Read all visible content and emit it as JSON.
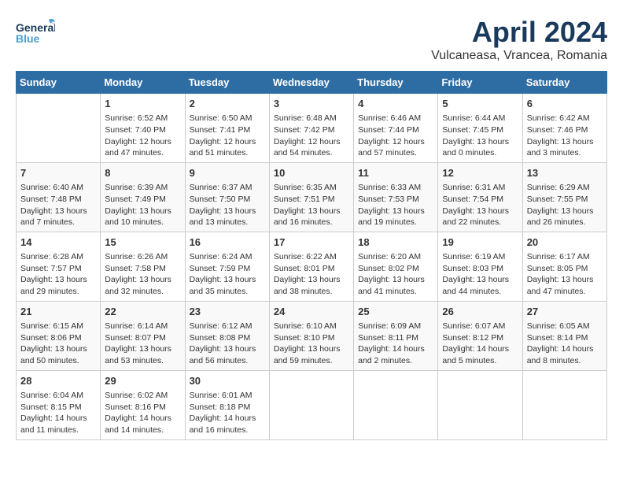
{
  "header": {
    "logo_general": "General",
    "logo_blue": "Blue",
    "month_title": "April 2024",
    "location": "Vulcaneasa, Vrancea, Romania"
  },
  "days_of_week": [
    "Sunday",
    "Monday",
    "Tuesday",
    "Wednesday",
    "Thursday",
    "Friday",
    "Saturday"
  ],
  "weeks": [
    [
      {
        "day": "",
        "info": ""
      },
      {
        "day": "1",
        "info": "Sunrise: 6:52 AM\nSunset: 7:40 PM\nDaylight: 12 hours\nand 47 minutes."
      },
      {
        "day": "2",
        "info": "Sunrise: 6:50 AM\nSunset: 7:41 PM\nDaylight: 12 hours\nand 51 minutes."
      },
      {
        "day": "3",
        "info": "Sunrise: 6:48 AM\nSunset: 7:42 PM\nDaylight: 12 hours\nand 54 minutes."
      },
      {
        "day": "4",
        "info": "Sunrise: 6:46 AM\nSunset: 7:44 PM\nDaylight: 12 hours\nand 57 minutes."
      },
      {
        "day": "5",
        "info": "Sunrise: 6:44 AM\nSunset: 7:45 PM\nDaylight: 13 hours\nand 0 minutes."
      },
      {
        "day": "6",
        "info": "Sunrise: 6:42 AM\nSunset: 7:46 PM\nDaylight: 13 hours\nand 3 minutes."
      }
    ],
    [
      {
        "day": "7",
        "info": "Sunrise: 6:40 AM\nSunset: 7:48 PM\nDaylight: 13 hours\nand 7 minutes."
      },
      {
        "day": "8",
        "info": "Sunrise: 6:39 AM\nSunset: 7:49 PM\nDaylight: 13 hours\nand 10 minutes."
      },
      {
        "day": "9",
        "info": "Sunrise: 6:37 AM\nSunset: 7:50 PM\nDaylight: 13 hours\nand 13 minutes."
      },
      {
        "day": "10",
        "info": "Sunrise: 6:35 AM\nSunset: 7:51 PM\nDaylight: 13 hours\nand 16 minutes."
      },
      {
        "day": "11",
        "info": "Sunrise: 6:33 AM\nSunset: 7:53 PM\nDaylight: 13 hours\nand 19 minutes."
      },
      {
        "day": "12",
        "info": "Sunrise: 6:31 AM\nSunset: 7:54 PM\nDaylight: 13 hours\nand 22 minutes."
      },
      {
        "day": "13",
        "info": "Sunrise: 6:29 AM\nSunset: 7:55 PM\nDaylight: 13 hours\nand 26 minutes."
      }
    ],
    [
      {
        "day": "14",
        "info": "Sunrise: 6:28 AM\nSunset: 7:57 PM\nDaylight: 13 hours\nand 29 minutes."
      },
      {
        "day": "15",
        "info": "Sunrise: 6:26 AM\nSunset: 7:58 PM\nDaylight: 13 hours\nand 32 minutes."
      },
      {
        "day": "16",
        "info": "Sunrise: 6:24 AM\nSunset: 7:59 PM\nDaylight: 13 hours\nand 35 minutes."
      },
      {
        "day": "17",
        "info": "Sunrise: 6:22 AM\nSunset: 8:01 PM\nDaylight: 13 hours\nand 38 minutes."
      },
      {
        "day": "18",
        "info": "Sunrise: 6:20 AM\nSunset: 8:02 PM\nDaylight: 13 hours\nand 41 minutes."
      },
      {
        "day": "19",
        "info": "Sunrise: 6:19 AM\nSunset: 8:03 PM\nDaylight: 13 hours\nand 44 minutes."
      },
      {
        "day": "20",
        "info": "Sunrise: 6:17 AM\nSunset: 8:05 PM\nDaylight: 13 hours\nand 47 minutes."
      }
    ],
    [
      {
        "day": "21",
        "info": "Sunrise: 6:15 AM\nSunset: 8:06 PM\nDaylight: 13 hours\nand 50 minutes."
      },
      {
        "day": "22",
        "info": "Sunrise: 6:14 AM\nSunset: 8:07 PM\nDaylight: 13 hours\nand 53 minutes."
      },
      {
        "day": "23",
        "info": "Sunrise: 6:12 AM\nSunset: 8:08 PM\nDaylight: 13 hours\nand 56 minutes."
      },
      {
        "day": "24",
        "info": "Sunrise: 6:10 AM\nSunset: 8:10 PM\nDaylight: 13 hours\nand 59 minutes."
      },
      {
        "day": "25",
        "info": "Sunrise: 6:09 AM\nSunset: 8:11 PM\nDaylight: 14 hours\nand 2 minutes."
      },
      {
        "day": "26",
        "info": "Sunrise: 6:07 AM\nSunset: 8:12 PM\nDaylight: 14 hours\nand 5 minutes."
      },
      {
        "day": "27",
        "info": "Sunrise: 6:05 AM\nSunset: 8:14 PM\nDaylight: 14 hours\nand 8 minutes."
      }
    ],
    [
      {
        "day": "28",
        "info": "Sunrise: 6:04 AM\nSunset: 8:15 PM\nDaylight: 14 hours\nand 11 minutes."
      },
      {
        "day": "29",
        "info": "Sunrise: 6:02 AM\nSunset: 8:16 PM\nDaylight: 14 hours\nand 14 minutes."
      },
      {
        "day": "30",
        "info": "Sunrise: 6:01 AM\nSunset: 8:18 PM\nDaylight: 14 hours\nand 16 minutes."
      },
      {
        "day": "",
        "info": ""
      },
      {
        "day": "",
        "info": ""
      },
      {
        "day": "",
        "info": ""
      },
      {
        "day": "",
        "info": ""
      }
    ]
  ]
}
